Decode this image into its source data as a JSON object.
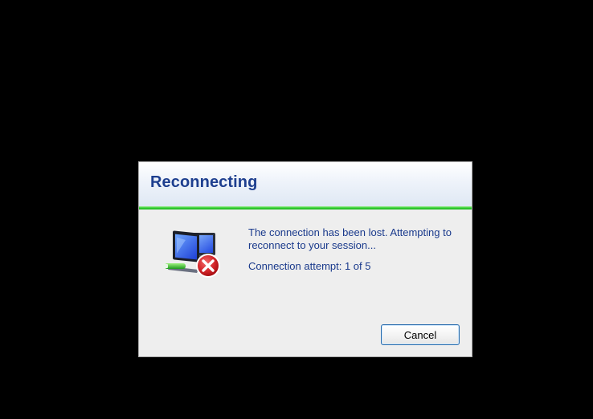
{
  "dialog": {
    "title": "Reconnecting",
    "message": "The connection has been lost. Attempting to reconnect to your session...",
    "attempt_status": "Connection attempt: 1 of 5",
    "status_icon": "network-computer-error-icon",
    "cancel_label": "Cancel"
  },
  "colors": {
    "background": "#000000",
    "dialog_bg": "#eeeeee",
    "title_color": "#1e3f8f",
    "text_color": "#1a3a8c",
    "accent_line": "#2fcf2f",
    "error_red": "#c8161c"
  }
}
